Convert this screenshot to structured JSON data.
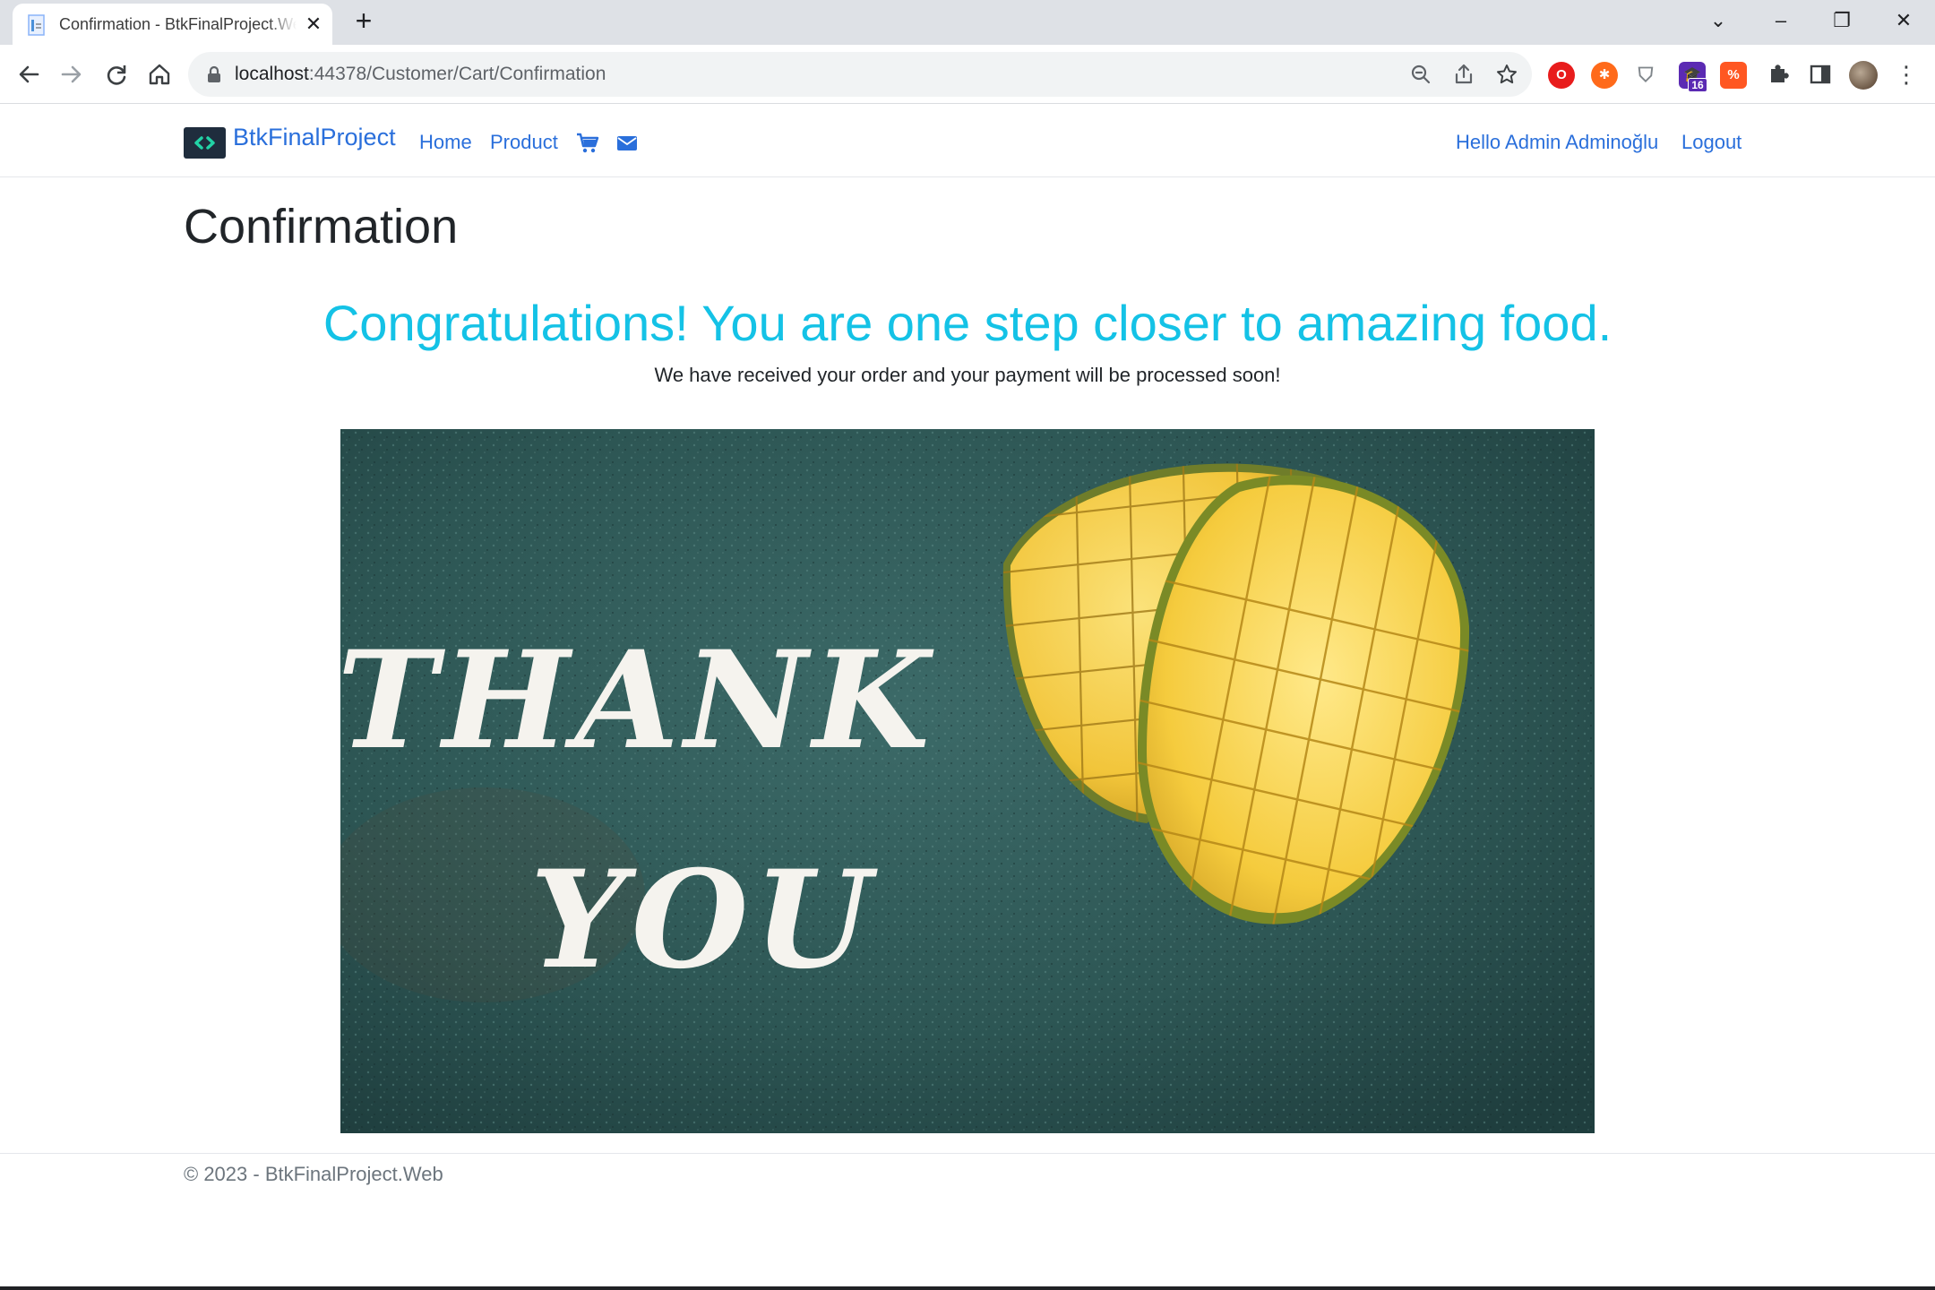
{
  "browser": {
    "tab_title": "Confirmation - BtkFinalProject.Web",
    "url_host": "localhost",
    "url_rest": ":44378/Customer/Cart/Confirmation",
    "extension_badge": "16",
    "extension_badge_color": "#5b2ab3"
  },
  "nav": {
    "brand": "BtkFinalProject",
    "links": [
      "Home",
      "Product"
    ],
    "greeting": "Hello Admin Adminoğlu",
    "logout": "Logout",
    "link_color": "#2a6fdb"
  },
  "main": {
    "title": "Confirmation",
    "headline": "Congratulations! You are one step closer to amazing food.",
    "headline_color": "#14c2e6",
    "message": "We have received your order and your payment will be processed soon!",
    "image": {
      "text_line1": "THANK",
      "text_line2": "YOU"
    }
  },
  "footer": {
    "text": "© 2023 - BtkFinalProject.Web"
  }
}
